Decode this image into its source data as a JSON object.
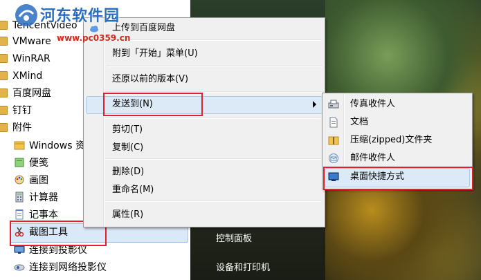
{
  "start_menu": {
    "items": [
      {
        "label": "TencentVideo",
        "icon": "folder-icon"
      },
      {
        "label": "VMware",
        "icon": "folder-icon"
      },
      {
        "label": "WinRAR",
        "icon": "folder-icon"
      },
      {
        "label": "XMind",
        "icon": "folder-icon"
      },
      {
        "label": "百度网盘",
        "icon": "folder-icon"
      },
      {
        "label": "钉钉",
        "icon": "folder-icon"
      },
      {
        "label": "附件",
        "icon": "folder-icon"
      },
      {
        "label": "Windows 资",
        "icon": "explorer-icon"
      },
      {
        "label": "便笺",
        "icon": "sticky-note-icon"
      },
      {
        "label": "画图",
        "icon": "paint-icon"
      },
      {
        "label": "计算器",
        "icon": "calculator-icon"
      },
      {
        "label": "记事本",
        "icon": "notepad-icon"
      },
      {
        "label": "截图工具",
        "icon": "scissors-icon"
      },
      {
        "label": "连接到投影仪",
        "icon": "projector-icon"
      },
      {
        "label": "连接到网络投影仪",
        "icon": "network-projector-icon"
      }
    ]
  },
  "right_panel": {
    "items": [
      {
        "label": "控制面板"
      },
      {
        "label": "设备和打印机"
      }
    ]
  },
  "context_menu": {
    "items": [
      {
        "label": "上传到百度网盘"
      },
      {
        "label": "附到「开始」菜单(U)"
      },
      {
        "label": "还原以前的版本(V)"
      },
      {
        "label": "发送到(N)",
        "has_submenu": true
      },
      {
        "label": "剪切(T)"
      },
      {
        "label": "复制(C)"
      },
      {
        "label": "删除(D)"
      },
      {
        "label": "重命名(M)"
      },
      {
        "label": "属性(R)"
      }
    ]
  },
  "sendto_submenu": {
    "items": [
      {
        "label": "传真收件人",
        "icon": "fax-icon"
      },
      {
        "label": "文档",
        "icon": "document-icon"
      },
      {
        "label": "压缩(zipped)文件夹",
        "icon": "zip-folder-icon"
      },
      {
        "label": "邮件收件人",
        "icon": "mail-icon"
      },
      {
        "label": "桌面快捷方式",
        "icon": "desktop-icon"
      }
    ]
  },
  "watermark": {
    "title": "河东软件园",
    "url": "www.pc0359.cn"
  },
  "colors": {
    "highlight_box": "#e0202e",
    "selection": "#dce9f7",
    "watermark_blue": "#2a6dbf",
    "watermark_red": "#d22b1e"
  }
}
